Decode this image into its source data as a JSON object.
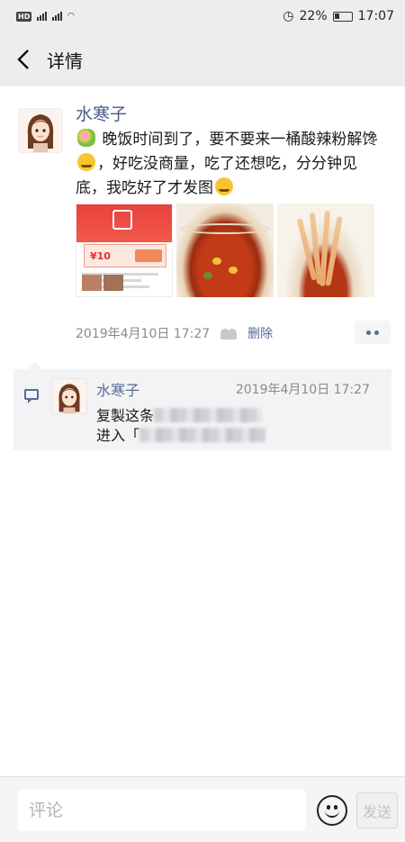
{
  "status_bar": {
    "left": "HD 4G 4G",
    "battery": "22%",
    "time": "17:07"
  },
  "nav": {
    "title": "详情"
  },
  "post": {
    "author": "水寒子",
    "text_part1": "晚饭时间到了，要不要来一桶酸辣粉解馋",
    "text_part2": "，好吃没商量，吃了还想吃，分分钟见底，我吃好了才发图",
    "shop_coupon": "¥10",
    "timestamp": "2019年4月10日 17:27",
    "delete_label": "删除"
  },
  "comment": {
    "author": "水寒子",
    "time": "2019年4月10日 17:27",
    "line1_visible": "复製这条",
    "line2_visible": "进入「"
  },
  "input_bar": {
    "placeholder": "评论",
    "send_label": "发送"
  },
  "colors": {
    "nav_bg": "#ededed",
    "link_blue": "#576b95",
    "name_blue": "#4a5a8a",
    "comment_bg": "#f3f3f5"
  }
}
